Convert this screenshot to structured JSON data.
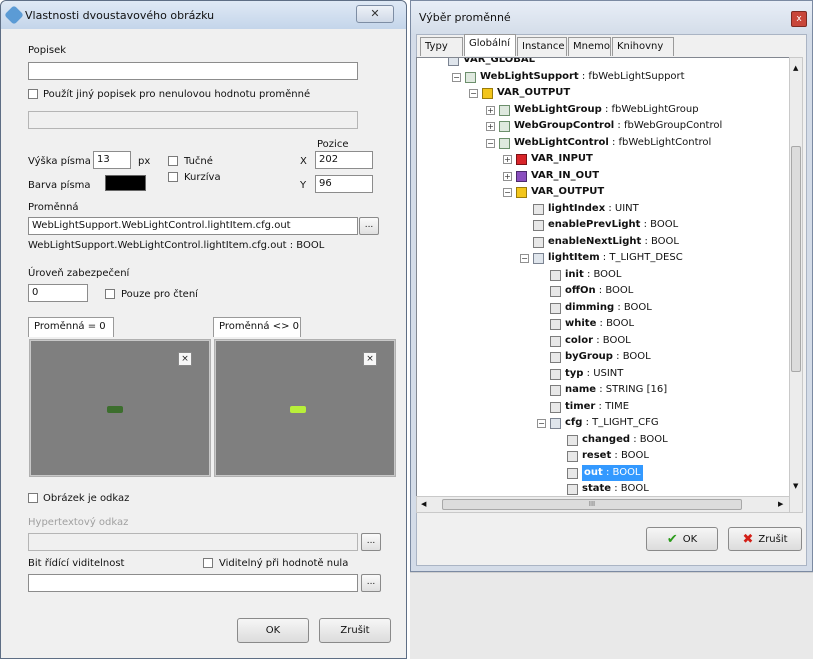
{
  "left": {
    "title": "Vlastnosti dvoustavového obrázku",
    "close_label": "✕",
    "popisek_label": "Popisek",
    "popisek_value": "",
    "use_other_label": "Použít jiný popisek pro nenulovou hodnotu proměnné",
    "other_label_value": "",
    "pozice_label": "Pozice",
    "font_height_label": "Výška písma",
    "font_height_value": "13",
    "px_label": "px",
    "bold_label": "Tučné",
    "italic_label": "Kurzíva",
    "x_label": "X",
    "x_value": "202",
    "y_label": "Y",
    "y_value": "96",
    "font_color_label": "Barva písma",
    "font_color": "#000000",
    "variable_label": "Proměnná",
    "variable_value": "WebLightSupport.WebLightControl.lightItem.cfg.out",
    "variable_browse": "...",
    "variable_type": "WebLightSupport.WebLightControl.lightItem.cfg.out : BOOL",
    "security_label": "Úroveň zabezpečení",
    "security_value": "0",
    "readonly_label": "Pouze pro čtení",
    "tab_zero": "Proměnná = 0",
    "tab_nonzero": "Proměnná <> 0",
    "preview_close": "×",
    "led_off_color": "#3c6e2d",
    "led_on_color": "#b8ef3a",
    "image_link_label": "Obrázek je odkaz",
    "hyperlink_label": "Hypertextový odkaz",
    "hyperlink_value": "",
    "hyperlink_browse": "...",
    "visibility_bit_label": "Bit řídící viditelnost",
    "visible_zero_label": "Viditelný při hodnotě nula",
    "visibility_value": "",
    "visibility_browse": "...",
    "ok_label": "OK",
    "cancel_label": "Zrušit"
  },
  "right": {
    "title": "Výběr proměnné",
    "close_label": "x",
    "tabs": [
      "Typy",
      "Globální",
      "Instance",
      "Mnemo",
      "Knihovny"
    ],
    "active_tab": "Globální",
    "tree": [
      {
        "indent": 0,
        "exp": "",
        "icon": "struct",
        "bold": "VAR_GLOBAL",
        "type": ""
      },
      {
        "indent": 1,
        "exp": "−",
        "icon": "fb",
        "bold": "WebLightSupport",
        "type": " : fbWebLightSupport"
      },
      {
        "indent": 2,
        "exp": "−",
        "icon": "out",
        "bold": "VAR_OUTPUT",
        "type": ""
      },
      {
        "indent": 3,
        "exp": "+",
        "icon": "fb",
        "bold": "WebLightGroup",
        "type": " : fbWebLightGroup"
      },
      {
        "indent": 3,
        "exp": "+",
        "icon": "fb",
        "bold": "WebGroupControl",
        "type": " : fbWebGroupControl"
      },
      {
        "indent": 3,
        "exp": "−",
        "icon": "fb",
        "bold": "WebLightControl",
        "type": " : fbWebLightControl"
      },
      {
        "indent": 4,
        "exp": "+",
        "icon": "in",
        "bold": "VAR_INPUT",
        "type": ""
      },
      {
        "indent": 4,
        "exp": "+",
        "icon": "inout",
        "bold": "VAR_IN_OUT",
        "type": ""
      },
      {
        "indent": 4,
        "exp": "−",
        "icon": "out",
        "bold": "VAR_OUTPUT",
        "type": ""
      },
      {
        "indent": 5,
        "exp": "",
        "icon": "var",
        "bold": "lightIndex",
        "type": " : UINT"
      },
      {
        "indent": 5,
        "exp": "",
        "icon": "var",
        "bold": "enablePrevLight",
        "type": " : BOOL"
      },
      {
        "indent": 5,
        "exp": "",
        "icon": "var",
        "bold": "enableNextLight",
        "type": " : BOOL"
      },
      {
        "indent": 5,
        "exp": "−",
        "icon": "struct",
        "bold": "lightItem",
        "type": " : T_LIGHT_DESC"
      },
      {
        "indent": 6,
        "exp": "",
        "icon": "var",
        "bold": "init",
        "type": " : BOOL"
      },
      {
        "indent": 6,
        "exp": "",
        "icon": "var",
        "bold": "offOn",
        "type": " : BOOL"
      },
      {
        "indent": 6,
        "exp": "",
        "icon": "var",
        "bold": "dimming",
        "type": " : BOOL"
      },
      {
        "indent": 6,
        "exp": "",
        "icon": "var",
        "bold": "white",
        "type": " : BOOL"
      },
      {
        "indent": 6,
        "exp": "",
        "icon": "var",
        "bold": "color",
        "type": " : BOOL"
      },
      {
        "indent": 6,
        "exp": "",
        "icon": "var",
        "bold": "byGroup",
        "type": " : BOOL"
      },
      {
        "indent": 6,
        "exp": "",
        "icon": "var",
        "bold": "typ",
        "type": " : USINT"
      },
      {
        "indent": 6,
        "exp": "",
        "icon": "var",
        "bold": "name",
        "type": " : STRING [16]"
      },
      {
        "indent": 6,
        "exp": "",
        "icon": "var",
        "bold": "timer",
        "type": " : TIME"
      },
      {
        "indent": 6,
        "exp": "−",
        "icon": "struct",
        "bold": "cfg",
        "type": " : T_LIGHT_CFG"
      },
      {
        "indent": 7,
        "exp": "",
        "icon": "var",
        "bold": "changed",
        "type": " : BOOL"
      },
      {
        "indent": 7,
        "exp": "",
        "icon": "var",
        "bold": "reset",
        "type": " : BOOL"
      },
      {
        "indent": 7,
        "exp": "",
        "icon": "var",
        "bold": "out",
        "type": " : BOOL",
        "selected": true
      },
      {
        "indent": 7,
        "exp": "",
        "icon": "var",
        "bold": "state",
        "type": " : BOOL"
      }
    ],
    "hscroll_thumb": "III",
    "ok_label": "OK",
    "cancel_label": "Zrušit"
  }
}
